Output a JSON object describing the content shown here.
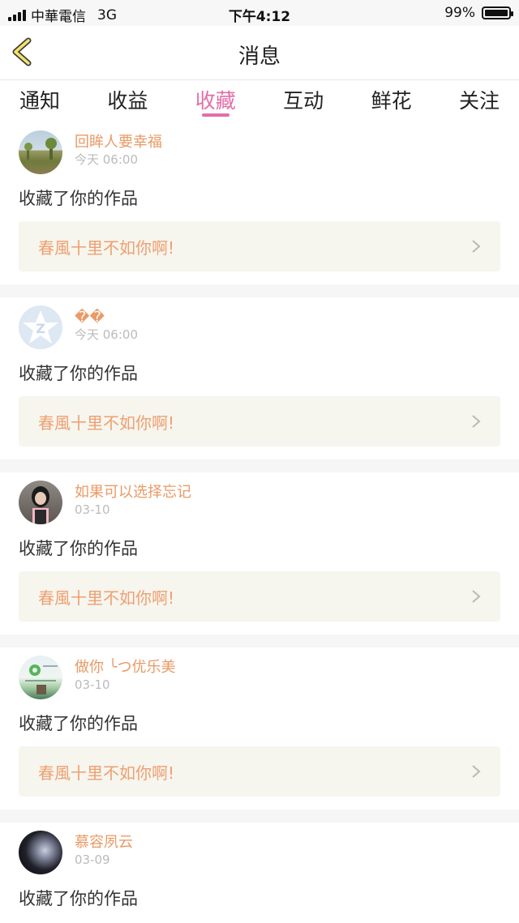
{
  "status_bar": {
    "carrier": "中華電信",
    "network": "3G",
    "time": "下午4:12",
    "battery": "99%",
    "battery_level": 0.99
  },
  "nav": {
    "title": "消息",
    "back_icon": "chevron-left-icon"
  },
  "tabs": [
    {
      "label": "通知",
      "active": false
    },
    {
      "label": "收益",
      "active": false
    },
    {
      "label": "收藏",
      "active": true
    },
    {
      "label": "互动",
      "active": false
    },
    {
      "label": "鲜花",
      "active": false
    },
    {
      "label": "关注",
      "active": false
    }
  ],
  "colors": {
    "accent": "#e26ea8",
    "username": "#e99a66",
    "work_title": "#eea070",
    "card_bg": "#f6f5ee"
  },
  "items": [
    {
      "username": "回眸人要幸福",
      "time": "今天 06:00",
      "action": "收藏了你的作品",
      "work_title": "春風十里不如你啊!"
    },
    {
      "username": "��",
      "time": "今天 06:00",
      "action": "收藏了你的作品",
      "work_title": "春風十里不如你啊!"
    },
    {
      "username": "如果可以选择忘记",
      "time": "03-10",
      "action": "收藏了你的作品",
      "work_title": "春風十里不如你啊!"
    },
    {
      "username": "做你 ╰つ优乐美",
      "time": "03-10",
      "action": "收藏了你的作品",
      "work_title": "春風十里不如你啊!"
    },
    {
      "username": "慕容夙云",
      "time": "03-09",
      "action": "收藏了你的作品"
    }
  ]
}
